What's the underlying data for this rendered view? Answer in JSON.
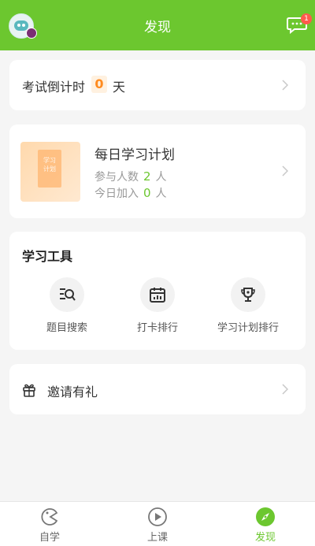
{
  "colors": {
    "brand": "#6cc72f",
    "accent_orange": "#ff8b1f",
    "badge_red": "#ff5a4e"
  },
  "header": {
    "title": "发现",
    "message_badge": "1"
  },
  "countdown": {
    "label": "考试倒计时",
    "value": "0",
    "unit": "天"
  },
  "daily_plan": {
    "title": "每日学习计划",
    "cover_text": "学习计划",
    "participants_label": "参与人数",
    "participants_value": "2",
    "participants_unit": "人",
    "today_label": "今日加入",
    "today_value": "0",
    "today_unit": "人"
  },
  "tools": {
    "title": "学习工具",
    "items": [
      {
        "label": "题目搜索",
        "icon": "search-list-icon"
      },
      {
        "label": "打卡排行",
        "icon": "calendar-chart-icon"
      },
      {
        "label": "学习计划排行",
        "icon": "trophy-icon"
      }
    ]
  },
  "invite": {
    "label": "邀请有礼",
    "icon": "gift-icon"
  },
  "tabbar": {
    "items": [
      {
        "label": "自学",
        "icon": "pacman-icon",
        "active": false
      },
      {
        "label": "上课",
        "icon": "play-circle-icon",
        "active": false
      },
      {
        "label": "发现",
        "icon": "compass-icon",
        "active": true
      }
    ]
  }
}
